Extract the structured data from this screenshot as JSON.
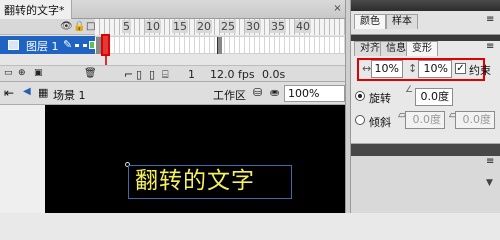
{
  "document": {
    "tab_title": "翻转的文字*",
    "close_glyph": "×"
  },
  "timeline": {
    "header_icons": {
      "eye": "👁",
      "lock": "🔒",
      "outline": "□"
    },
    "ruler_numbers": [
      "5",
      "10",
      "15",
      "20",
      "25",
      "30",
      "35",
      "40"
    ],
    "layer": {
      "name": "图层 1",
      "pencil": "✎"
    },
    "status": {
      "frame": "1",
      "fps": "12.0 fps",
      "time": "0.0s"
    }
  },
  "editbar": {
    "scene": "场景 1",
    "workspace": "工作区",
    "zoom": "100%"
  },
  "stage": {
    "text": "翻转的文字"
  },
  "panels": {
    "top_tabs": [
      "颜色",
      "样本"
    ],
    "transform_tabs": [
      "对齐",
      "信息",
      "变形"
    ],
    "scale_w": "10%",
    "scale_h": "10%",
    "constrain_label": "约束",
    "constrain_checked": true,
    "rotate_label": "旋转",
    "rotate_value": "0.0度",
    "skew_label": "倾斜",
    "skew_h": "0.0度",
    "skew_v": "0.0度"
  },
  "colors": {
    "layer_selected": "#1f63c3",
    "stage_bg": "#000000",
    "text": "#f4f15a",
    "highlight": "#e00000"
  }
}
